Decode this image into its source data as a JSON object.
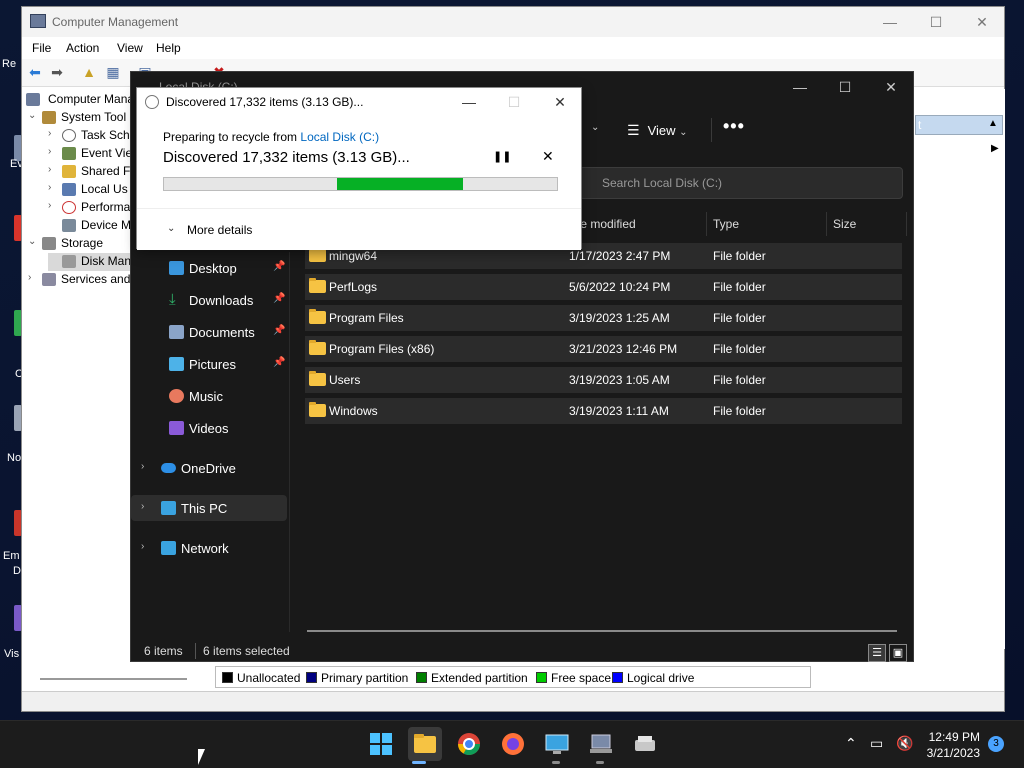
{
  "desktop": {
    "labels": [
      "Re",
      "Ev",
      "C",
      "No",
      "Em",
      "D",
      "Vis"
    ]
  },
  "cm": {
    "title": "Computer Management",
    "menu": [
      "File",
      "Action",
      "View",
      "Help"
    ],
    "tree": [
      {
        "label": "Computer Mana",
        "expander": ""
      },
      {
        "label": "System Tool",
        "expander": "⌄"
      },
      {
        "label": "Task Sch",
        "expander": "›"
      },
      {
        "label": "Event Vie",
        "expander": "›"
      },
      {
        "label": "Shared F",
        "expander": "›"
      },
      {
        "label": "Local Us",
        "expander": "›"
      },
      {
        "label": "Performa",
        "expander": "›"
      },
      {
        "label": "Device M",
        "expander": ""
      },
      {
        "label": "Storage",
        "expander": "⌄"
      },
      {
        "label": "Disk Man",
        "expander": ""
      },
      {
        "label": "Services and",
        "expander": "›"
      }
    ],
    "actions_header": "t",
    "actions_item": "s",
    "legend": [
      {
        "label": "Unallocated",
        "color": "#000000"
      },
      {
        "label": "Primary partition",
        "color": "#00007f"
      },
      {
        "label": "Extended partition",
        "color": "#007f00"
      },
      {
        "label": "Free space",
        "color": "#00cc00"
      },
      {
        "label": "Logical drive",
        "color": "#0000ff"
      }
    ]
  },
  "explorer": {
    "title": "Local Disk (C:)",
    "view_label": "View",
    "more_label": "•••",
    "search_placeholder": "Search Local Disk (C:)",
    "columns": {
      "date": "te modified",
      "type": "Type",
      "size": "Size"
    },
    "nav": [
      {
        "label": "Desktop",
        "pinned": true,
        "icon_color": "#3a96dd"
      },
      {
        "label": "Downloads",
        "pinned": true,
        "icon_color": "#2fb36a"
      },
      {
        "label": "Documents",
        "pinned": true,
        "icon_color": "#8aa4c8"
      },
      {
        "label": "Pictures",
        "pinned": true,
        "icon_color": "#4db2e8"
      },
      {
        "label": "Music",
        "pinned": false,
        "icon_color": "#e8795e"
      },
      {
        "label": "Videos",
        "pinned": false,
        "icon_color": "#8a5ad8"
      },
      {
        "label": "OneDrive",
        "pinned": false,
        "icon_color": "#2d8fe6"
      },
      {
        "label": "This PC",
        "pinned": false,
        "icon_color": "#3aa3e0"
      },
      {
        "label": "Network",
        "pinned": false,
        "icon_color": "#3aa3e0"
      }
    ],
    "rows": [
      {
        "name": "mingw64",
        "date": "1/17/2023 2:47 PM",
        "type": "File folder"
      },
      {
        "name": "PerfLogs",
        "date": "5/6/2022 10:24 PM",
        "type": "File folder"
      },
      {
        "name": "Program Files",
        "date": "3/19/2023 1:25 AM",
        "type": "File folder"
      },
      {
        "name": "Program Files (x86)",
        "date": "3/21/2023 12:46 PM",
        "type": "File folder"
      },
      {
        "name": "Users",
        "date": "3/19/2023 1:05 AM",
        "type": "File folder"
      },
      {
        "name": "Windows",
        "date": "3/19/2023 1:11 AM",
        "type": "File folder"
      }
    ],
    "status_items": "6 items",
    "status_selected": "6 items selected"
  },
  "dialog": {
    "title": "Discovered 17,332 items (3.13 GB)...",
    "preparing": "Preparing to recycle from ",
    "source": "Local Disk (C:)",
    "main_text": "Discovered 17,332 items (3.13 GB)...",
    "more_details": "More details",
    "progress_fill_start": 0.44,
    "progress_fill_end": 0.76
  },
  "taskbar": {
    "time": "12:49 PM",
    "date": "3/21/2023",
    "notification_count": "3"
  },
  "colors": {
    "progress": "#06b025",
    "folder": "#f6c343",
    "link": "#0067c0",
    "explorer_bg": "#191919"
  }
}
